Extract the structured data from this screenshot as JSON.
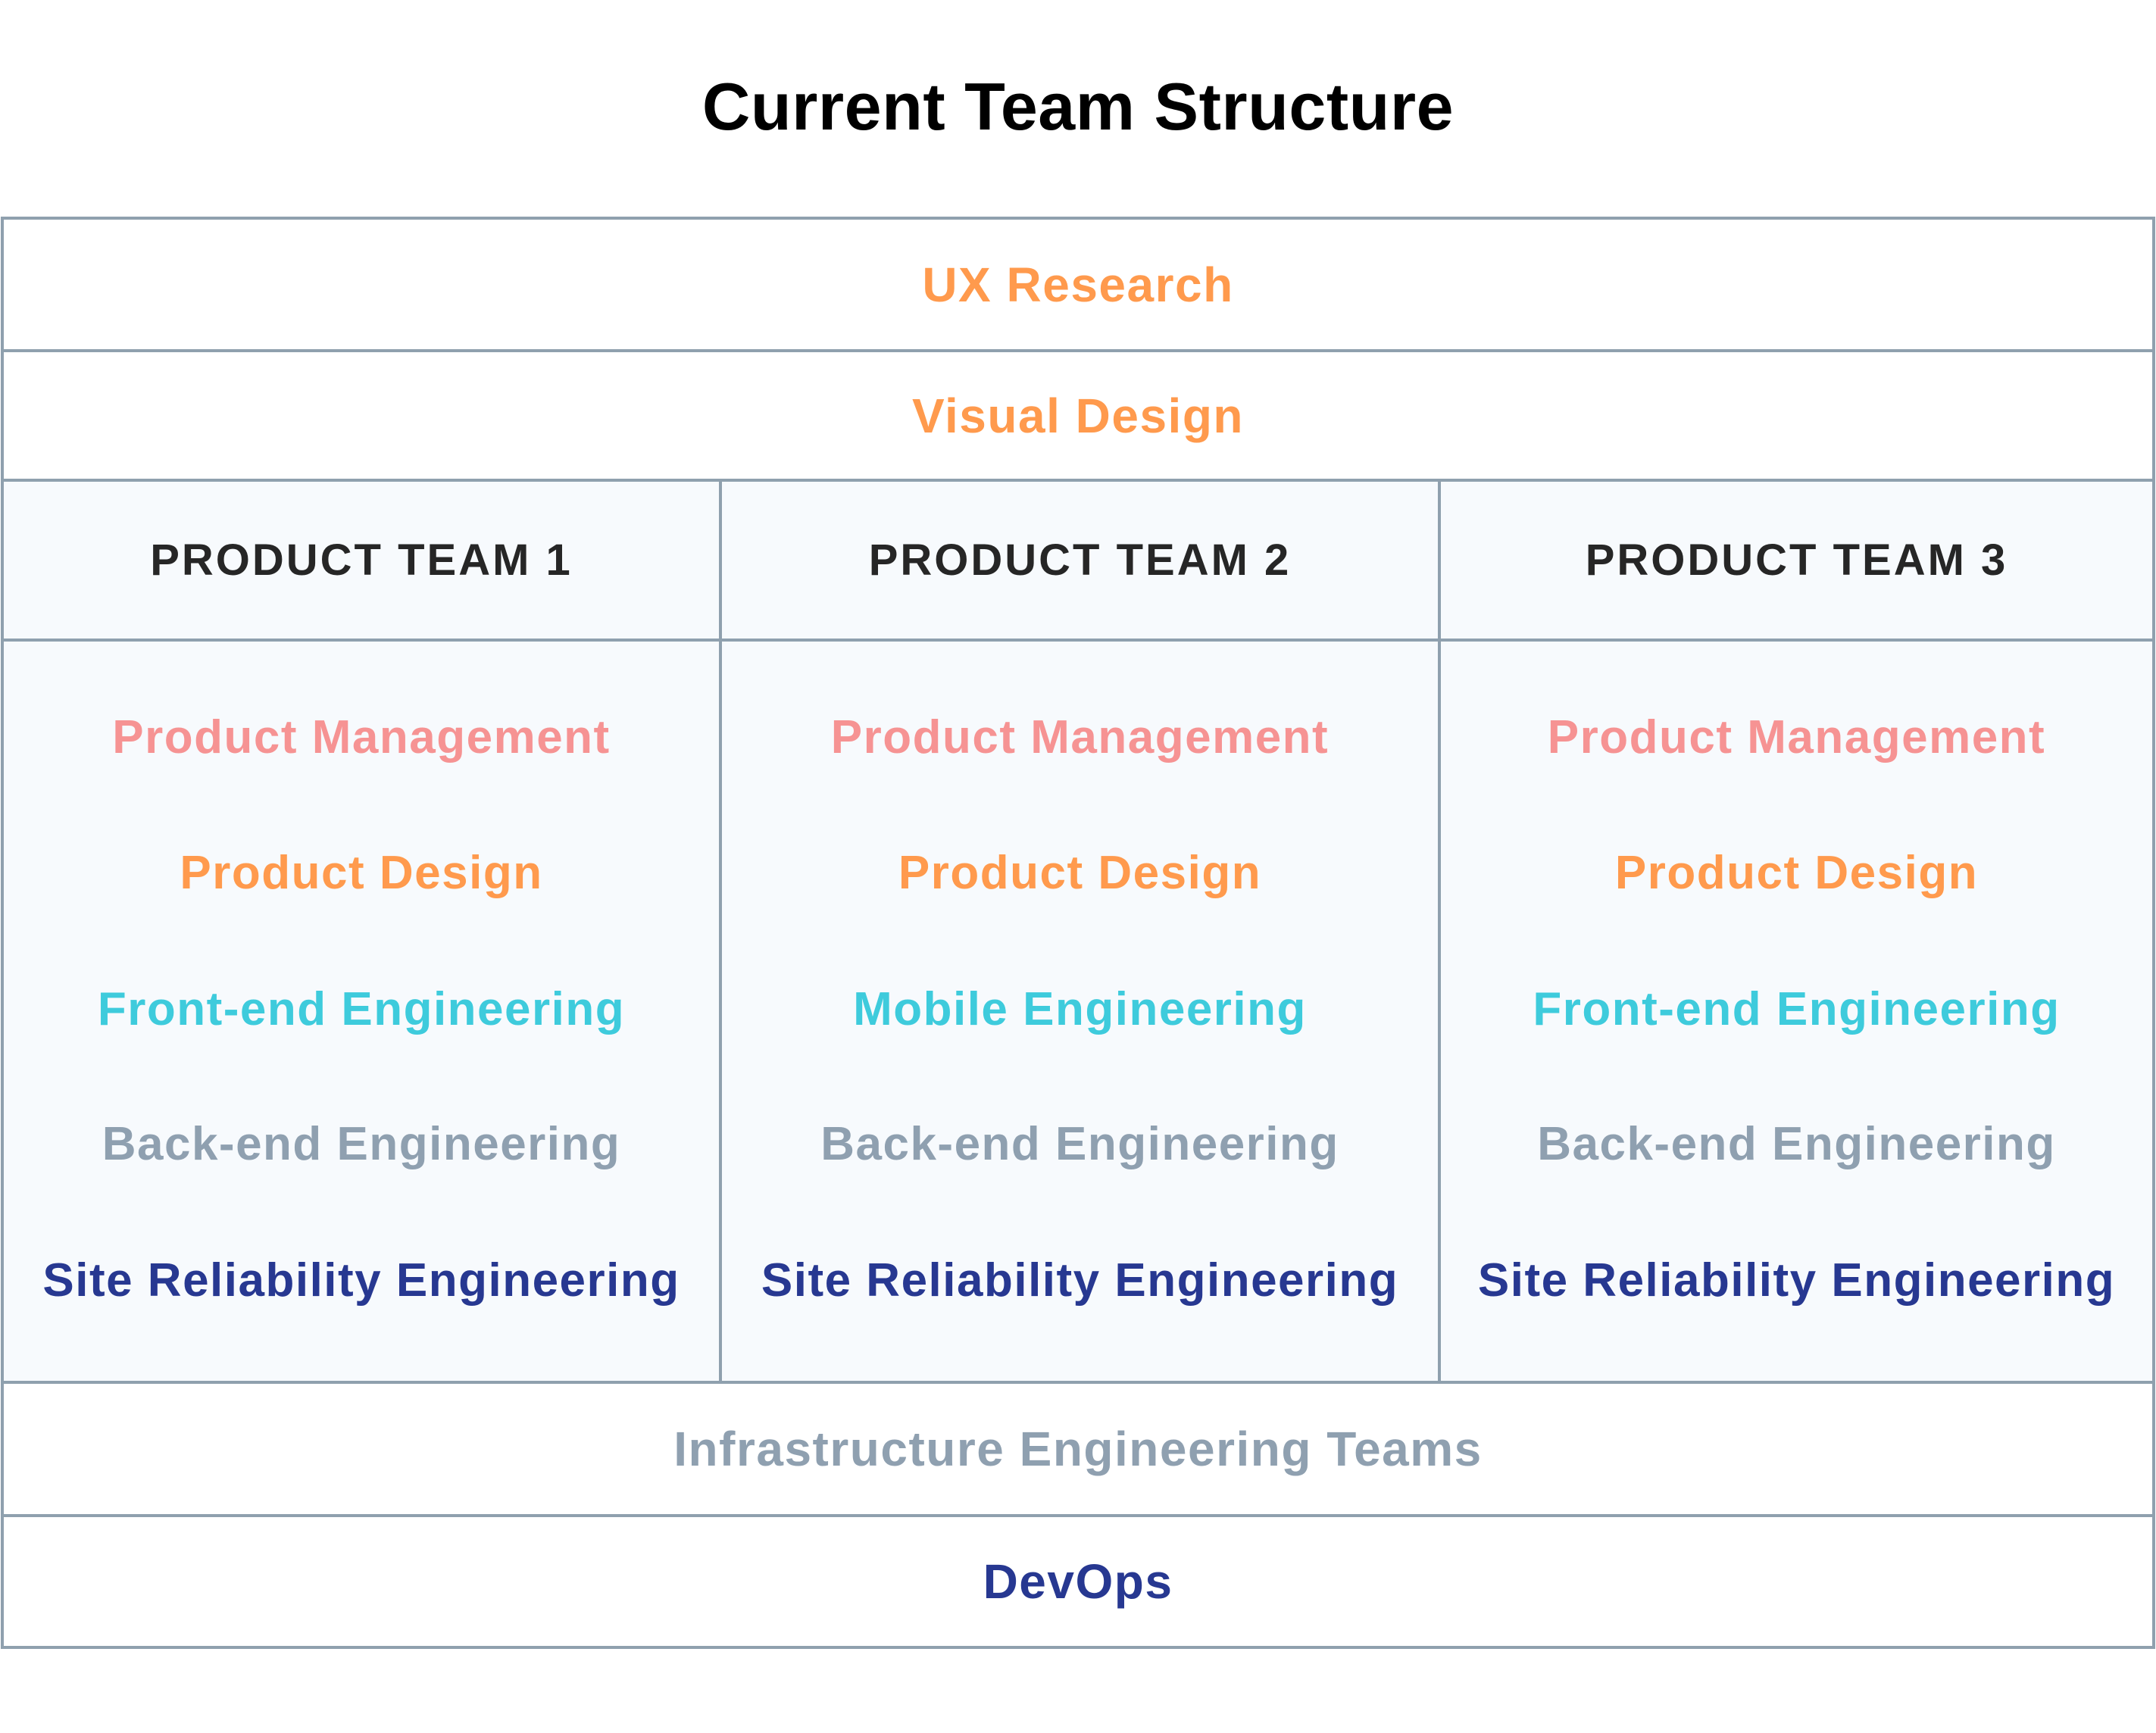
{
  "title": "Current Team Structure",
  "colors": {
    "orange": "#ff9a4d",
    "pink": "#f69393",
    "cyan": "#3ecbdc",
    "gray": "#8fa0b0",
    "navy": "#273891",
    "header_text": "#262626",
    "border": "#8fa0ae",
    "team_background": "#f7fafd"
  },
  "top_rows": [
    {
      "label": "UX Research",
      "color": "orange"
    },
    {
      "label": "Visual Design",
      "color": "orange"
    }
  ],
  "product_teams": [
    {
      "header": "PRODUCT TEAM 1",
      "functions": [
        {
          "label": "Product Management",
          "color": "pink"
        },
        {
          "label": "Product Design",
          "color": "orange"
        },
        {
          "label": "Front-end Engineering",
          "color": "cyan"
        },
        {
          "label": "Back-end Engineering",
          "color": "gray"
        },
        {
          "label": "Site Reliability Engineering",
          "color": "navy"
        }
      ]
    },
    {
      "header": "PRODUCT TEAM 2",
      "functions": [
        {
          "label": "Product Management",
          "color": "pink"
        },
        {
          "label": "Product Design",
          "color": "orange"
        },
        {
          "label": "Mobile Engineering",
          "color": "cyan"
        },
        {
          "label": "Back-end Engineering",
          "color": "gray"
        },
        {
          "label": "Site Reliability Engineering",
          "color": "navy"
        }
      ]
    },
    {
      "header": "PRODUCT TEAM 3",
      "functions": [
        {
          "label": "Product Management",
          "color": "pink"
        },
        {
          "label": "Product Design",
          "color": "orange"
        },
        {
          "label": "Front-end Engineering",
          "color": "cyan"
        },
        {
          "label": "Back-end Engineering",
          "color": "gray"
        },
        {
          "label": "Site Reliability Engineering",
          "color": "navy"
        }
      ]
    }
  ],
  "bottom_rows": [
    {
      "label": "Infrastructure Engineering Teams",
      "color": "gray"
    },
    {
      "label": "DevOps",
      "color": "navy"
    }
  ]
}
